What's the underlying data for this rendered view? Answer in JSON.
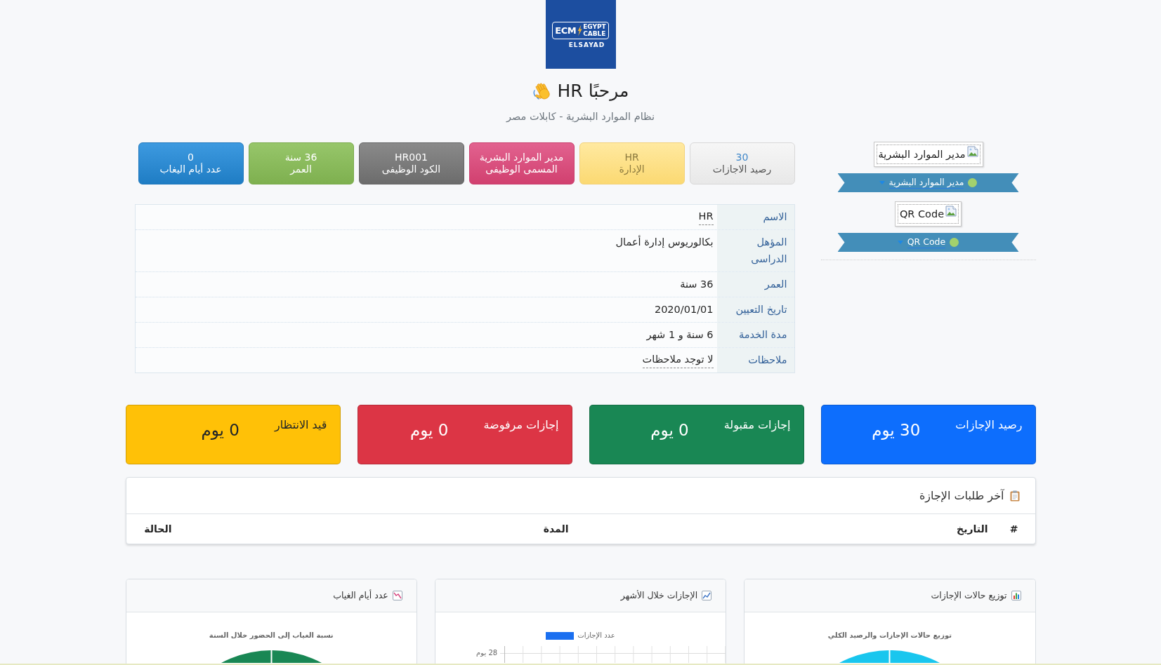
{
  "logo": {
    "mark": "ECM",
    "name_lines": [
      "EGYPT",
      "CABLE"
    ],
    "tagline": "ELSAYAD"
  },
  "header": {
    "greeting": "مرحبًا HR",
    "subtitle": "نظام الموارد البشرية - كابلات مصر"
  },
  "profile_cards": [
    {
      "image_alt": "مدير الموارد البشرية",
      "link": "مدير الموارد البشرية",
      "online": true
    },
    {
      "image_alt": "QR Code",
      "link": "QR Code",
      "online": true
    }
  ],
  "stat_buttons": [
    {
      "kind": "light",
      "value": "30",
      "label": "رصيد الاجازات"
    },
    {
      "kind": "yellow",
      "value": "HR",
      "label": "الإدارة"
    },
    {
      "kind": "pink",
      "value": "مدير الموارد البشرية",
      "label": "المسمى الوظيفى"
    },
    {
      "kind": "dark",
      "value": "HR001",
      "label": "الكود الوظيفى"
    },
    {
      "kind": "green",
      "value": "36 سنة",
      "label": "العمر"
    },
    {
      "kind": "blue",
      "value": "0",
      "label": "عدد أيام اليغاب"
    }
  ],
  "details": [
    {
      "label": "الاسم",
      "value": "HR",
      "editable": true
    },
    {
      "label": "المؤهل الدراسى",
      "value": "بكالوريوس إدارة أعمال",
      "editable": false
    },
    {
      "label": "العمر",
      "value": "36 سنة",
      "editable": false
    },
    {
      "label": "تاريخ التعيين",
      "value": "2020/01/01",
      "editable": false
    },
    {
      "label": "مدة الخدمة",
      "value": "6 سنة و 1 شهر",
      "editable": false
    },
    {
      "label": "ملاحظات",
      "value": "لا توجد ملاحظات",
      "editable": true
    }
  ],
  "summary_cards": [
    {
      "title": "رصيد الإجازات",
      "value": "30 يوم",
      "color": "#0d6efd"
    },
    {
      "title": "إجازات مقبولة",
      "value": "0 يوم",
      "color": "#198754"
    },
    {
      "title": "إجازات مرفوضة",
      "value": "0 يوم",
      "color": "#dc3545"
    },
    {
      "title": "قيد الانتظار",
      "value": "0 يوم",
      "color": "#ffc107"
    }
  ],
  "recent_requests": {
    "title": "آخر طلبات الإجازة",
    "columns": [
      "#",
      "التاريخ",
      "المدة",
      "الحالة"
    ]
  },
  "charts": [
    {
      "title": "توزيع حالات الإجازات",
      "kind": "pie",
      "chart_title": "توزيع حالات الإجازات والرصيد الكلي"
    },
    {
      "title": "الإجازات خلال الأشهر",
      "kind": "bar",
      "legend": "عدد الإجازات",
      "y_tick": "28 يوم"
    },
    {
      "title": "عدد أيام الغياب",
      "kind": "pie",
      "chart_title": "نسبة الغياب إلى الحضور خلال السنة"
    }
  ]
}
